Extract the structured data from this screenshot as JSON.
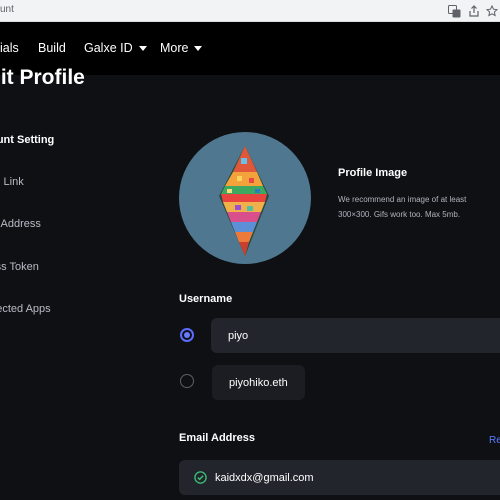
{
  "browser": {
    "tab_title": "unt"
  },
  "nav": {
    "items": [
      {
        "label": "ials"
      },
      {
        "label": "Build"
      },
      {
        "label": "Galxe ID"
      },
      {
        "label": "More"
      }
    ]
  },
  "page": {
    "title": "dit Profile"
  },
  "sidebar": {
    "items": [
      {
        "label": "count Setting"
      },
      {
        "label": "cial Link"
      },
      {
        "label": "llet Address"
      },
      {
        "label": "cess Token"
      },
      {
        "label": "nnected Apps"
      }
    ]
  },
  "profile_image": {
    "heading": "Profile Image",
    "description": "We recommend an image of at least 300×300. Gifs work too. Max 5mb."
  },
  "username": {
    "label": "Username",
    "value": "piyo",
    "ens_option": "piyohiko.eth"
  },
  "email": {
    "label": "Email Address",
    "reset_link": "Re",
    "value": "kaidxdx@gmail.com"
  },
  "colors": {
    "accent": "#5b6cff",
    "verified": "#3cc37a",
    "link": "#5b7cff"
  }
}
